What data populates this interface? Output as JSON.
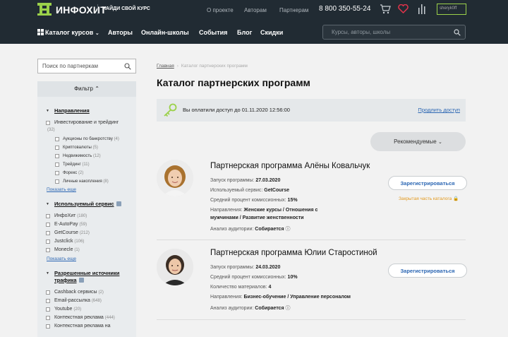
{
  "header": {
    "logo_text": "ИНФОХИТ",
    "slogan": "НАЙДИ СВОЙ КУРС",
    "top_links": [
      "О проекте",
      "Авторам",
      "Партнерам"
    ],
    "phone": "8 800 350-55-24",
    "user_name": "sheryk0ff",
    "nav": {
      "catalog": "Каталог курсов",
      "authors": "Авторы",
      "schools": "Онлайн-школы",
      "events": "События",
      "blog": "Блог",
      "discounts": "Скидки"
    },
    "search_placeholder": "Курсы, авторы, школы"
  },
  "sidebar": {
    "search_placeholder": "Поиск по партнеркам",
    "filter_label": "Фильтр",
    "directions": {
      "title": "Направления",
      "items": [
        {
          "label": "Инвестирование и трейдинг",
          "count": "(32)"
        },
        {
          "label": "Аукционы по банкротству",
          "count": "(4)"
        },
        {
          "label": "Криптовалюты",
          "count": "(5)"
        },
        {
          "label": "Недвижимость",
          "count": "(12)"
        },
        {
          "label": "Трейдинг",
          "count": "(11)"
        },
        {
          "label": "Форекс",
          "count": "(2)"
        },
        {
          "label": "Личные накопления",
          "count": "(8)"
        }
      ],
      "show_more": "Показать еще"
    },
    "services": {
      "title": "Используемый сервис",
      "items": [
        {
          "label": "ИнфоХит",
          "count": "(180)"
        },
        {
          "label": "E-AutoPay",
          "count": "(59)"
        },
        {
          "label": "GetCourse",
          "count": "(212)"
        },
        {
          "label": "Justclick",
          "count": "(106)"
        },
        {
          "label": "Monecle",
          "count": "(1)"
        }
      ],
      "show_more": "Показать еще"
    },
    "traffic": {
      "title_line1": "Разрешенные источники",
      "title_line2": "трафика",
      "items": [
        {
          "label": "Cashback сервисы",
          "count": "(2)"
        },
        {
          "label": "Email-рассылка",
          "count": "(648)"
        },
        {
          "label": "Youtube",
          "count": "(20)"
        },
        {
          "label": "Контекстная реклама",
          "count": "(444)"
        },
        {
          "label": "Контекстная реклама на",
          "count": ""
        }
      ]
    }
  },
  "main": {
    "breadcrumb_home": "Главная",
    "breadcrumb_current": "Каталог партнерских программ",
    "title": "Каталог партнерских программ",
    "access_text": "Вы оплатили доступ до 01.11.2020 12:56:00",
    "extend_link": "Продлить доступ",
    "sort_label": "Рекомендуемые",
    "cards": [
      {
        "title": "Партнерская программа Алёны Ковальчук",
        "launch_label": "Запуск программы:",
        "launch": "27.03.2020",
        "service_label": "Используемый сервис:",
        "service": "GetCourse",
        "commission_label": "Средний процент комиссионных:",
        "commission": "15%",
        "directions_label": "Направления:",
        "directions_1": "Женские курсы / Отношения с",
        "directions_2": "мужчинами / Развитие женственности",
        "audience_label": "Анализ аудитории:",
        "audience": "Собирается",
        "register": "Зарегистрироваться",
        "closed_note": "Закрытая часть каталога"
      },
      {
        "title": "Партнерская программа Юлии Старостиной",
        "launch_label": "Запуск программы:",
        "launch": "24.03.2020",
        "commission_label": "Средний процент комиссионных:",
        "commission": "10%",
        "materials_label": "Количество материалов:",
        "materials": "4",
        "directions_label": "Направления:",
        "directions_1": "Бизнес-обучение / Управление персоналом",
        "audience_label": "Анализ аудитории:",
        "audience": "Собирается",
        "register": "Зарегистрироваться"
      }
    ]
  },
  "colors": {
    "header_bg": "#212b33",
    "accent_green": "#9bd14a",
    "link_blue": "#2b66b3",
    "warning_orange": "#e39a20"
  }
}
